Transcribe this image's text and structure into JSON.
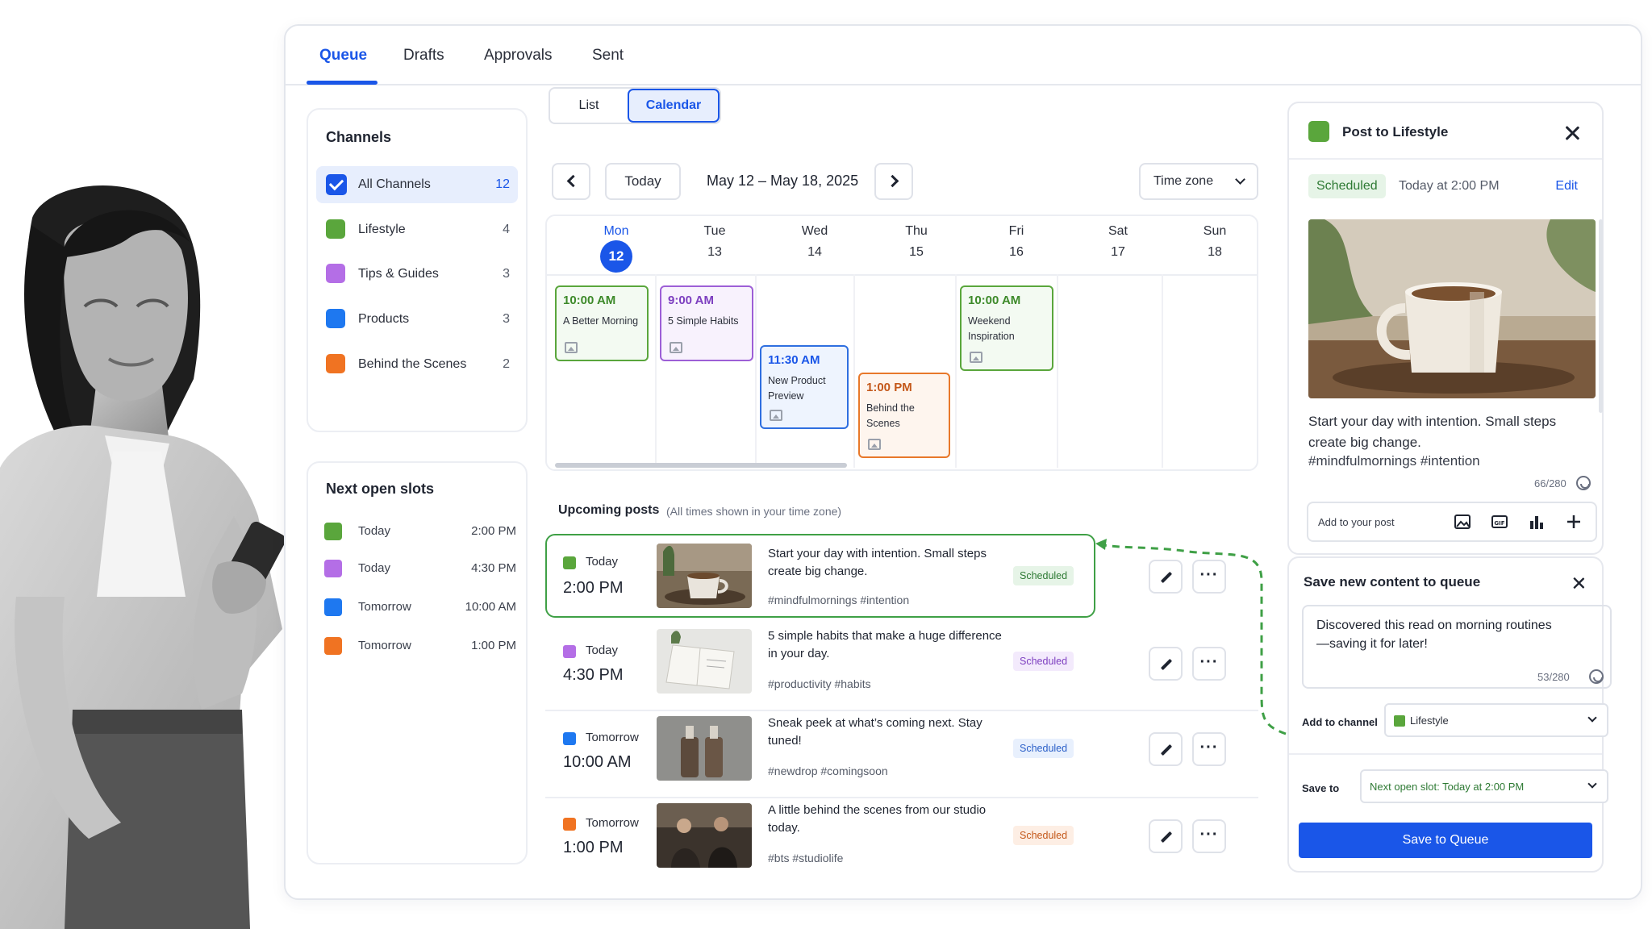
{
  "tabs": [
    {
      "label": "Queue",
      "active": true
    },
    {
      "label": "Drafts"
    },
    {
      "label": "Approvals"
    },
    {
      "label": "Sent"
    }
  ],
  "channels": {
    "title": "Channels",
    "items": [
      {
        "label": "All Channels",
        "count": "12",
        "selected": true
      },
      {
        "label": "Lifestyle",
        "count": "4",
        "color": "#5aa63c"
      },
      {
        "label": "Tips & Guides",
        "count": "3",
        "color": "#b46ee6"
      },
      {
        "label": "Products",
        "count": "3",
        "color": "#1e78f0"
      },
      {
        "label": "Behind the Scenes",
        "count": "2",
        "color": "#f07322"
      }
    ]
  },
  "open_slots": {
    "title": "Next open slots",
    "items": [
      {
        "day": "Today",
        "time": "2:00 PM",
        "color": "#5aa63c"
      },
      {
        "day": "Today",
        "time": "4:30 PM",
        "color": "#b46ee6"
      },
      {
        "day": "Tomorrow",
        "time": "10:00 AM",
        "color": "#1e78f0"
      },
      {
        "day": "Tomorrow",
        "time": "1:00 PM",
        "color": "#f07322"
      }
    ]
  },
  "view_toggle": {
    "list": "List",
    "calendar": "Calendar"
  },
  "calendar_nav": {
    "today": "Today",
    "range": "May 12 – May 18, 2025",
    "timezone": "Time zone"
  },
  "days": [
    {
      "name": "Mon",
      "num": "12",
      "active": true
    },
    {
      "name": "Tue",
      "num": "13"
    },
    {
      "name": "Wed",
      "num": "14"
    },
    {
      "name": "Thu",
      "num": "15"
    },
    {
      "name": "Fri",
      "num": "16"
    },
    {
      "name": "Sat",
      "num": "17"
    },
    {
      "name": "Sun",
      "num": "18"
    }
  ],
  "events": [
    {
      "time": "10:00 AM",
      "title": "A Better Morning",
      "color": "#5aa63c",
      "bg": "#f3faf2"
    },
    {
      "time": "9:00 AM",
      "title": "5 Simple Habits",
      "color": "#9d5fd6",
      "bg": "#f8f2fd"
    },
    {
      "time": "11:30 AM",
      "title": "New Product Preview",
      "color": "#2f6fe0",
      "bg": "#eef4fe"
    },
    {
      "time": "1:00 PM",
      "title": "Behind the Scenes",
      "color": "#e8782a",
      "bg": "#fef5ee"
    },
    {
      "time": "10:00 AM",
      "title": "Weekend Inspiration",
      "color": "#5aa63c",
      "bg": "#f3faf2"
    }
  ],
  "upcoming": {
    "title": "Upcoming posts",
    "subtitle": "(All times shown in your time zone)",
    "posts": [
      {
        "day": "Today",
        "time": "2:00 PM",
        "text": "Start your day with intention. Small steps create big change.",
        "tags": "#mindfulmornings #intention",
        "status": "Scheduled",
        "color": "#5aa63c",
        "badge_bg": "#e6f4e7",
        "badge_fg": "#2e7a34"
      },
      {
        "day": "Today",
        "time": "4:30 PM",
        "text": "5 simple habits that make a huge difference in your day.",
        "tags": "#productivity #habits",
        "status": "Scheduled",
        "color": "#b46ee6",
        "badge_bg": "#f3eafc",
        "badge_fg": "#7d3fc0"
      },
      {
        "day": "Tomorrow",
        "time": "10:00 AM",
        "text": "Sneak peek at what’s coming next. Stay tuned!",
        "tags": "#newdrop #comingsoon",
        "status": "Scheduled",
        "color": "#1e78f0",
        "badge_bg": "#e8f0fd",
        "badge_fg": "#2a5fc8"
      },
      {
        "day": "Tomorrow",
        "time": "1:00 PM",
        "text": "A little behind the scenes from our studio today.",
        "tags": "#bts #studiolife",
        "status": "Scheduled",
        "color": "#f07322",
        "badge_bg": "#fdeee4",
        "badge_fg": "#c4581a"
      }
    ]
  },
  "post_panel": {
    "title": "Post to Lifestyle",
    "status": "Scheduled",
    "when": "Today at 2:00 PM",
    "edit": "Edit",
    "text": "Start your day with intention. Small steps create big change.",
    "tags": "#mindfulmornings #intention",
    "count": "66/280",
    "add_label": "Add to your post",
    "color": "#5aa63c"
  },
  "save_panel": {
    "title": "Save new content to queue",
    "text": "Discovered this read on morning routines—saving it for later!",
    "count": "53/280",
    "channel_label": "Add to channel",
    "channel_value": "Lifestyle",
    "save_to_label": "Save to",
    "save_to_value": "Next open slot: Today at 2:00 PM",
    "button": "Save to Queue"
  }
}
